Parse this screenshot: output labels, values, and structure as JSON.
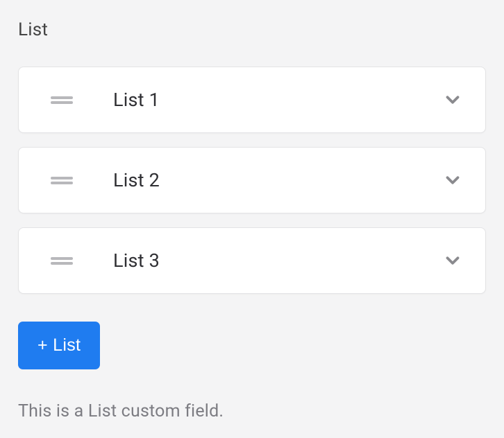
{
  "field": {
    "label": "List",
    "helper": "This is a List custom field."
  },
  "items": [
    {
      "label": "List 1"
    },
    {
      "label": "List 2"
    },
    {
      "label": "List 3"
    }
  ],
  "buttons": {
    "add_label": "+ List"
  },
  "icons": {
    "drag": "drag-handle-icon",
    "chevron": "chevron-down-icon"
  }
}
